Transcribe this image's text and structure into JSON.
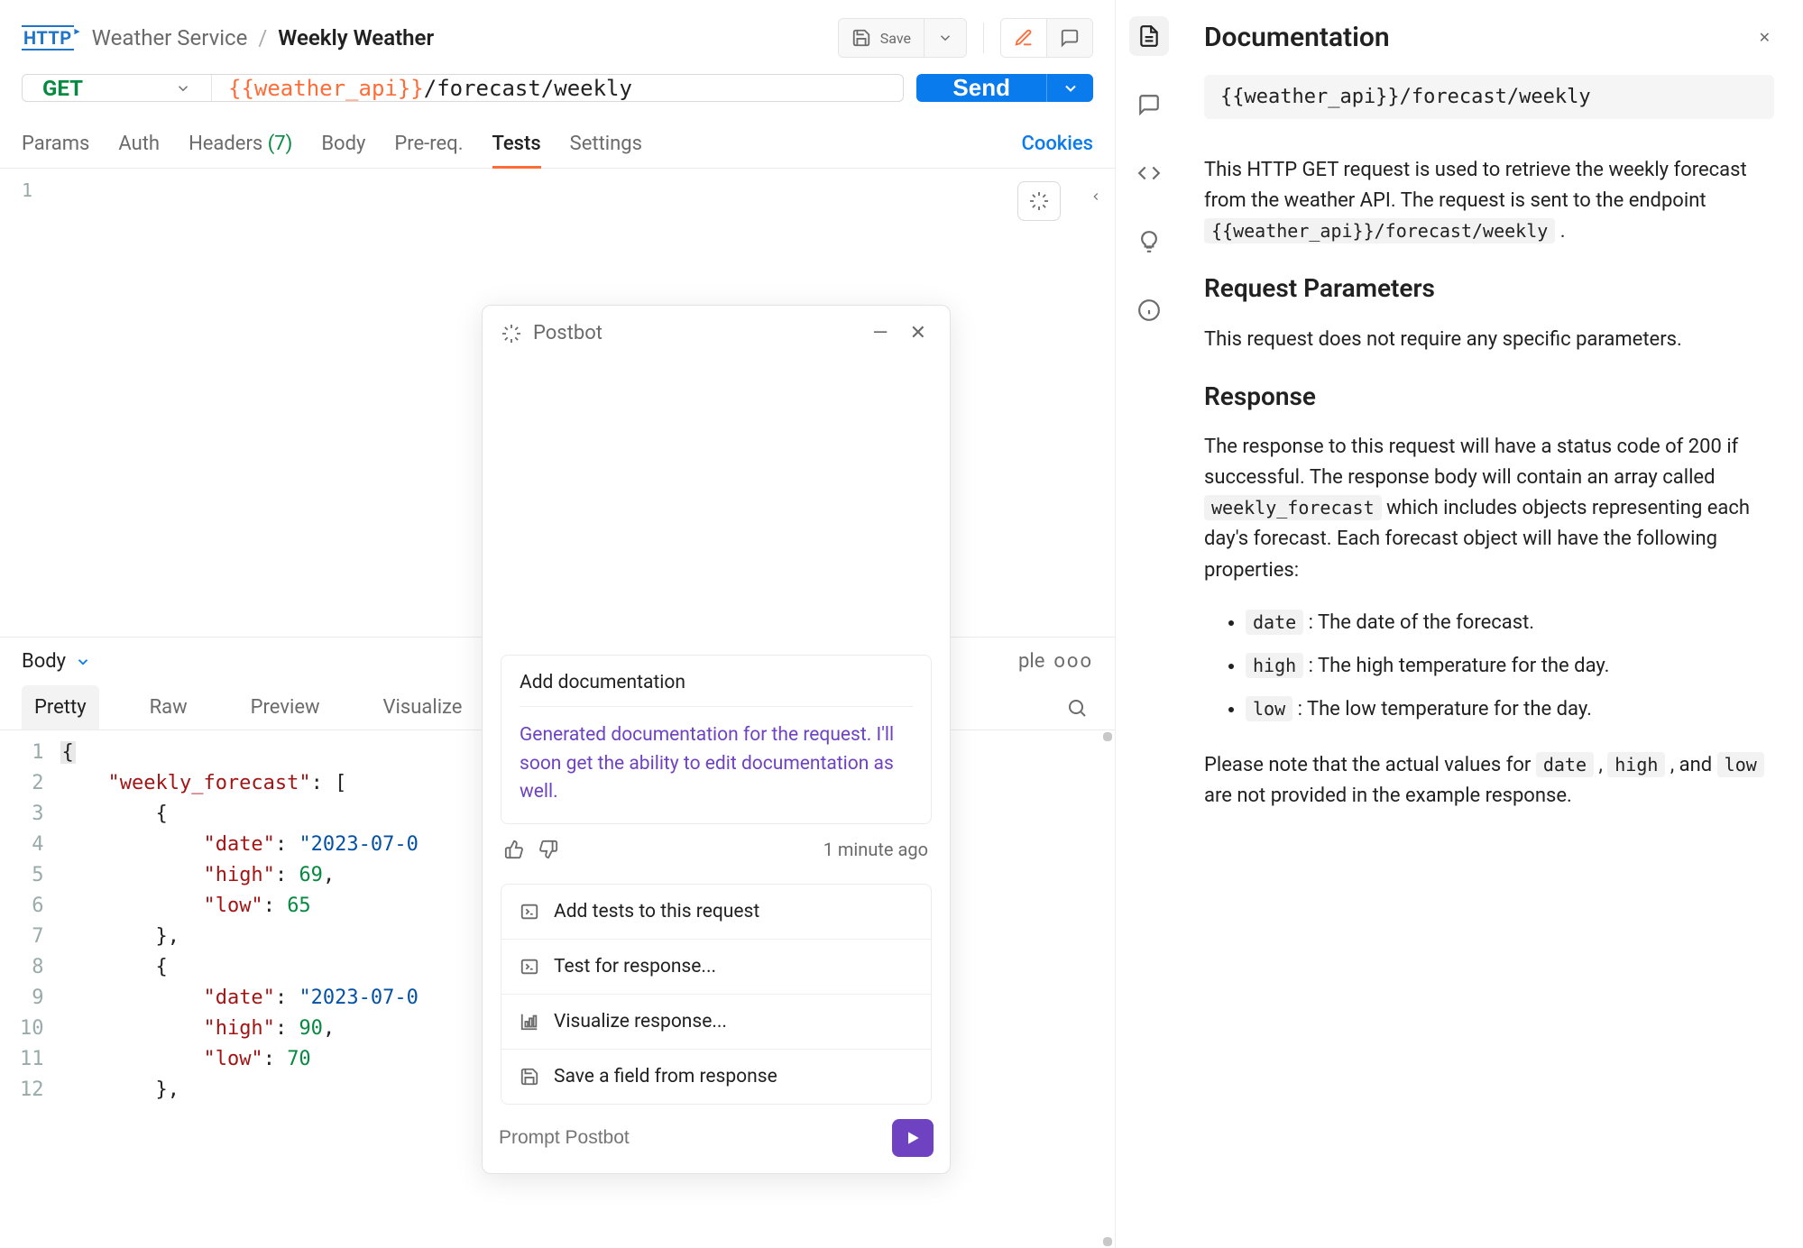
{
  "breadcrumb": {
    "parent": "Weather Service",
    "separator": "/",
    "current": "Weekly Weather"
  },
  "topbar": {
    "save_label": "Save"
  },
  "request": {
    "method": "GET",
    "url_var": "{{weather_api}}",
    "url_path": "/forecast/weekly",
    "send_label": "Send"
  },
  "tabs": {
    "params": "Params",
    "auth": "Auth",
    "headers": "Headers",
    "headers_count": "(7)",
    "body": "Body",
    "prereq": "Pre-req.",
    "tests": "Tests",
    "settings": "Settings",
    "cookies": "Cookies"
  },
  "editor": {
    "first_line_no": "1"
  },
  "response": {
    "section_label": "Body",
    "more_actions": "ooo",
    "view_tabs": {
      "pretty": "Pretty",
      "raw": "Raw",
      "preview": "Preview",
      "visualize": "Visualize"
    },
    "lines": [
      "1",
      "2",
      "3",
      "4",
      "5",
      "6",
      "7",
      "8",
      "9",
      "10",
      "11",
      "12"
    ],
    "json": {
      "key_root": "\"weekly_forecast\"",
      "key_date": "\"date\"",
      "key_high": "\"high\"",
      "key_low": "\"low\"",
      "val_date1": "\"2023-07-0",
      "val_high1": "69",
      "val_low1": "65",
      "val_date2": "\"2023-07-0",
      "val_high2": "90",
      "val_low2": "70"
    }
  },
  "postbot": {
    "title": "Postbot",
    "card_title": "Add documentation",
    "card_msg": "Generated documentation for the request. I'll soon get the ability to edit documentation as well.",
    "time": "1 minute ago",
    "suggestions": {
      "s1": "Add tests to this request",
      "s2": "Test for response...",
      "s3": "Visualize response...",
      "s4": "Save a field from response"
    },
    "prompt_placeholder": "Prompt Postbot"
  },
  "doc": {
    "title": "Documentation",
    "url": "{{weather_api}}/forecast/weekly",
    "intro_a": "This HTTP GET request is used to retrieve the weekly forecast from the weather API. The request is sent to the endpoint ",
    "intro_code": "{{weather_api}}/forecast/weekly",
    "intro_b": " .",
    "h_params": "Request Parameters",
    "p_params": "This request does not require any specific parameters.",
    "h_response": "Response",
    "p_response_a": "The response to this request will have a status code of 200 if successful. The response body will contain an array called ",
    "p_response_code": "weekly_forecast",
    "p_response_b": " which includes objects representing each day's forecast. Each forecast object will have the following properties:",
    "li_date_code": "date",
    "li_date_txt": " : The date of the forecast.",
    "li_high_code": "high",
    "li_high_txt": " : The high temperature for the day.",
    "li_low_code": "low",
    "li_low_txt": " : The low temperature for the day.",
    "note_a": "Please note that the actual values for ",
    "note_c1": "date",
    "note_m1": " , ",
    "note_c2": "high",
    "note_m2": " , and ",
    "note_c3": "low",
    "note_b": " are not provided in the example response."
  }
}
